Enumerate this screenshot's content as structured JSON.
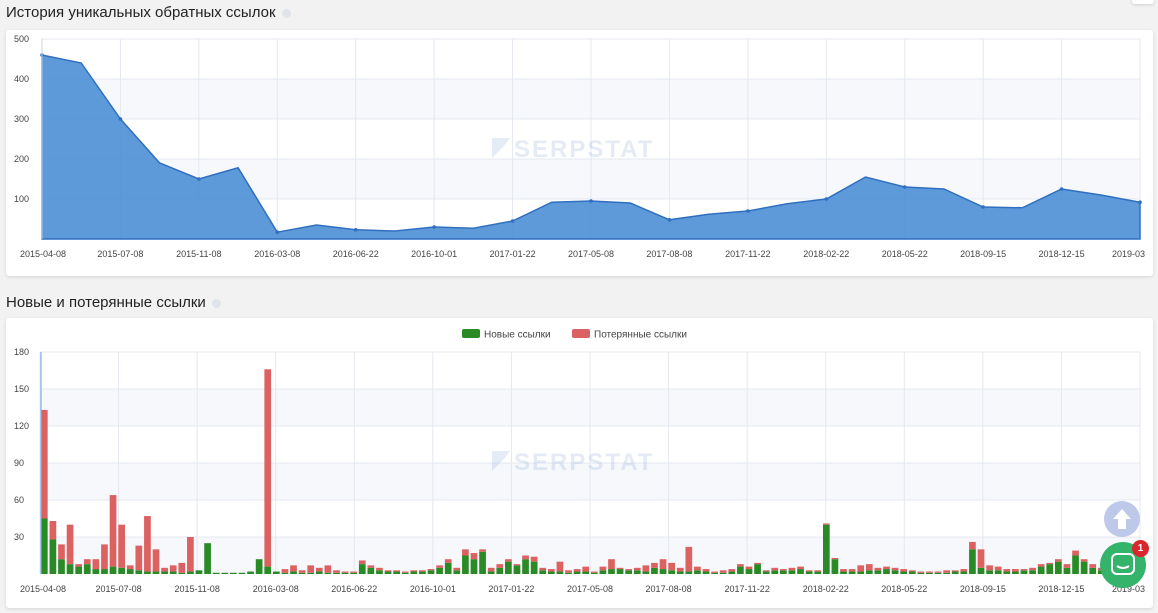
{
  "history_section": {
    "title": "История уникальных обратных ссылок"
  },
  "links_section": {
    "title": "Новые и потерянные ссылки"
  },
  "chat": {
    "badge": "1"
  },
  "watermark": "SERPSTAT",
  "chart_data": [
    {
      "type": "area",
      "title": "История уникальных обратных ссылок",
      "color": "#4d8fd6",
      "xlim": [
        "2015-04-08",
        "2019-03"
      ],
      "ylim": [
        0,
        500
      ],
      "yticks": [
        500,
        400,
        300,
        200,
        100
      ],
      "xticks": [
        "2015-04-08",
        "2015-07-08",
        "2015-11-08",
        "2016-03-08",
        "2016-06-22",
        "2016-10-01",
        "2017-01-22",
        "2017-05-08",
        "2017-08-08",
        "2017-11-22",
        "2018-02-22",
        "2018-05-22",
        "2018-09-15",
        "2018-12-15",
        "2019-03"
      ],
      "x": [
        0,
        0.5,
        1,
        1.5,
        2,
        2.5,
        3,
        3.5,
        4,
        4.5,
        5,
        5.5,
        6,
        6.5,
        7,
        7.5,
        8,
        8.5,
        9,
        9.5,
        10,
        10.5,
        11,
        11.5,
        12,
        12.5,
        13,
        13.5,
        14
      ],
      "values": [
        460,
        440,
        300,
        190,
        150,
        178,
        17,
        35,
        23,
        20,
        30,
        27,
        45,
        92,
        95,
        90,
        48,
        62,
        70,
        88,
        100,
        155,
        130,
        125,
        80,
        78,
        125,
        110,
        92
      ]
    },
    {
      "type": "bar",
      "title": "Новые и потерянные ссылки",
      "legend_position": "top",
      "xlim": [
        "2015-04-08",
        "2019-03"
      ],
      "ylim": [
        0,
        180
      ],
      "yticks": [
        180,
        150,
        120,
        90,
        60,
        30
      ],
      "xticks": [
        "2015-04-08",
        "2015-07-08",
        "2015-11-08",
        "2016-03-08",
        "2016-06-22",
        "2016-10-01",
        "2017-01-22",
        "2017-05-08",
        "2017-08-08",
        "2017-11-22",
        "2018-02-22",
        "2018-05-22",
        "2018-09-15",
        "2018-12-15",
        "2019-03"
      ],
      "series": [
        {
          "name": "Новые ссылки",
          "color": "#2a8a26",
          "values": [
            45,
            28,
            12,
            8,
            6,
            8,
            4,
            4,
            6,
            5,
            4,
            3,
            2,
            2,
            2,
            2,
            1,
            2,
            3,
            25,
            1,
            1,
            1,
            1,
            2,
            12,
            6,
            2,
            1,
            2,
            1,
            1,
            2,
            1,
            1,
            1,
            1,
            8,
            5,
            3,
            2,
            2,
            1,
            2,
            2,
            3,
            5,
            9,
            3,
            15,
            12,
            18,
            2,
            5,
            10,
            7,
            12,
            10,
            3,
            2,
            2,
            1,
            2,
            2,
            1,
            3,
            4,
            4,
            3,
            3,
            2,
            5,
            4,
            3,
            2,
            2,
            3,
            2,
            1,
            1,
            2,
            6,
            4,
            8,
            2,
            3,
            3,
            3,
            4,
            2,
            2,
            40,
            12,
            2,
            2,
            2,
            3,
            3,
            4,
            3,
            2,
            2,
            1,
            1,
            1,
            1,
            2,
            2,
            20,
            5,
            3,
            3,
            2,
            2,
            3,
            3,
            6,
            8,
            10,
            5,
            15,
            10,
            5,
            3,
            4,
            5,
            4,
            4
          ]
        },
        {
          "name": "Потерянные ссылки",
          "color": "#dc6262",
          "values": [
            88,
            15,
            12,
            32,
            2,
            4,
            8,
            20,
            58,
            35,
            3,
            20,
            45,
            18,
            3,
            5,
            8,
            28,
            0,
            0,
            0,
            0,
            0,
            0,
            0,
            0,
            160,
            0,
            3,
            5,
            2,
            6,
            3,
            6,
            2,
            1,
            1,
            3,
            2,
            2,
            1,
            1,
            1,
            1,
            1,
            1,
            2,
            3,
            2,
            5,
            5,
            2,
            3,
            3,
            2,
            1,
            3,
            4,
            2,
            2,
            8,
            2,
            2,
            4,
            1,
            3,
            8,
            1,
            1,
            2,
            5,
            4,
            8,
            6,
            3,
            20,
            3,
            2,
            1,
            2,
            2,
            2,
            2,
            1,
            1,
            2,
            1,
            2,
            2,
            1,
            1,
            1,
            1,
            2,
            2,
            5,
            5,
            2,
            2,
            2,
            2,
            1,
            1,
            1,
            1,
            2,
            1,
            2,
            6,
            15,
            4,
            3,
            2,
            2,
            1,
            2,
            2,
            1,
            2,
            3,
            4,
            2,
            3,
            2,
            3,
            5,
            8,
            8
          ]
        }
      ]
    }
  ]
}
